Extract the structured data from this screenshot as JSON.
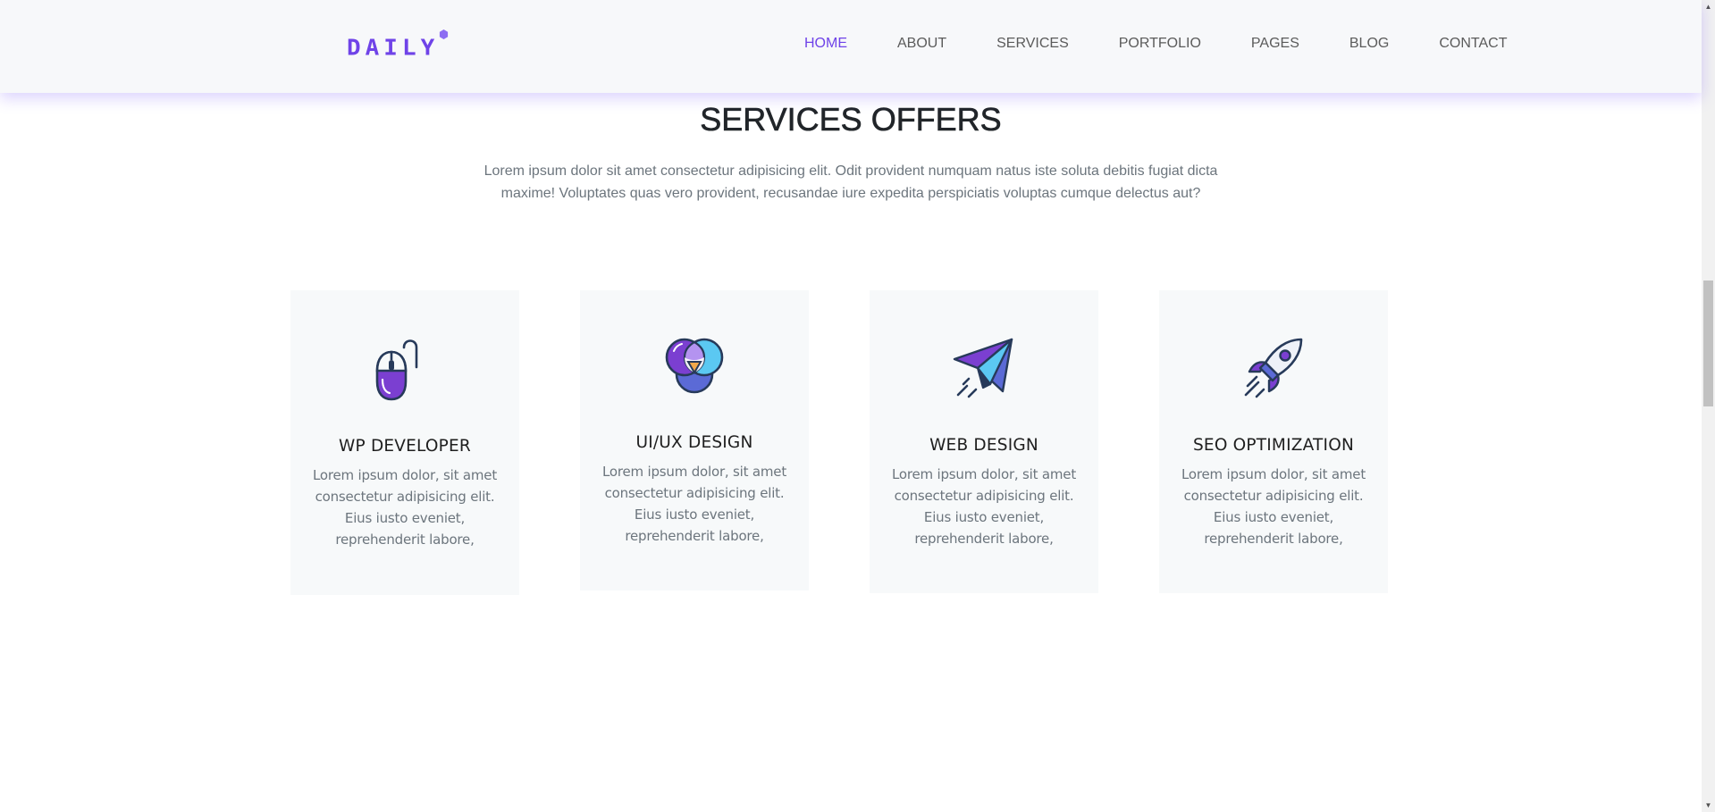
{
  "header": {
    "logo_text": "DAILY",
    "nav_items": [
      "HOME",
      "ABOUT",
      "SERVICES",
      "PORTFOLIO",
      "PAGES",
      "BLOG",
      "CONTACT"
    ],
    "active_item": "HOME"
  },
  "section": {
    "title": "SERVICES OFFERS",
    "description": "Lorem ipsum dolor sit amet consectetur adipisicing elit. Odit provident numquam natus iste soluta debitis fugiat dicta maxime! Voluptates quas vero provident, recusandae iure expedita perspiciatis voluptas cumque delectus aut?"
  },
  "services": [
    {
      "title": "WP DEVELOPER",
      "text": "Lorem ipsum dolor, sit amet consectetur adipisicing elit. Eius iusto eveniet, reprehenderit labore,",
      "icon": "computer-mouse-icon"
    },
    {
      "title": "UI/UX DESIGN",
      "text": "Lorem ipsum dolor, sit amet consectetur adipisicing elit. Eius iusto eveniet, reprehenderit labore,",
      "icon": "color-circles-icon"
    },
    {
      "title": "WEB DESIGN",
      "text": "Lorem ipsum dolor, sit amet consectetur adipisicing elit. Eius iusto eveniet, reprehenderit labore,",
      "icon": "paper-plane-icon"
    },
    {
      "title": "SEO OPTIMIZATION",
      "text": "Lorem ipsum dolor, sit amet consectetur adipisicing elit. Eius iusto eveniet, reprehenderit labore,",
      "icon": "rocket-icon"
    }
  ],
  "colors": {
    "accent": "#6f43e8",
    "header_bg": "#f7f8fa",
    "card_bg": "#f7f9fa",
    "icon_purple": "#7b3fd1",
    "icon_blue": "#5bc8f2",
    "icon_outline": "#273a5a"
  }
}
